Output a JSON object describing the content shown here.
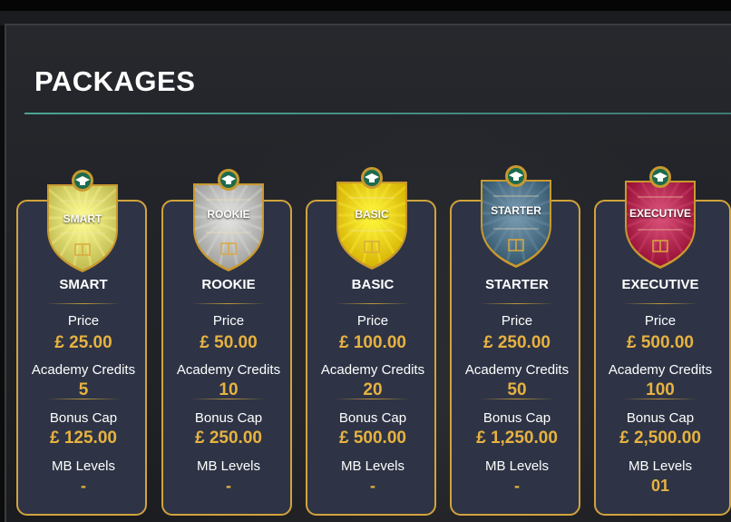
{
  "page": {
    "title": "PACKAGES"
  },
  "labels": {
    "price": "Price",
    "credits": "Academy Credits",
    "bonus": "Bonus Cap",
    "mb": "MB Levels"
  },
  "packages": [
    {
      "badge": "SMART",
      "name": "SMART",
      "price": "£ 25.00",
      "credits": "5",
      "bonus": "£ 125.00",
      "mb": "-",
      "color": "#d9d46a"
    },
    {
      "badge": "ROOKIE",
      "name": "ROOKIE",
      "price": "£ 50.00",
      "credits": "10",
      "bonus": "£ 250.00",
      "mb": "-",
      "color": "#b9b9b7"
    },
    {
      "badge": "BASIC",
      "name": "BASIC",
      "price": "£ 100.00",
      "credits": "20",
      "bonus": "£ 500.00",
      "mb": "-",
      "color": "#f2cc13"
    },
    {
      "badge": "STARTER",
      "name": "STARTER",
      "price": "£ 250.00",
      "credits": "50",
      "bonus": "£ 1,250.00",
      "mb": "-",
      "color": "#4e7187"
    },
    {
      "badge": "EXECUTIVE",
      "name": "EXECUTIVE",
      "price": "£ 500.00",
      "credits": "100",
      "bonus": "£ 2,500.00",
      "mb": "01",
      "color": "#b0274f"
    }
  ],
  "colors": {
    "accent_gold": "#e7b240",
    "card_border": "#d2a33c",
    "card_bg": "#2e3445",
    "title_rule": "#4fb0a0"
  },
  "icons": {
    "badge_emblem": "graduation-cap-icon"
  }
}
